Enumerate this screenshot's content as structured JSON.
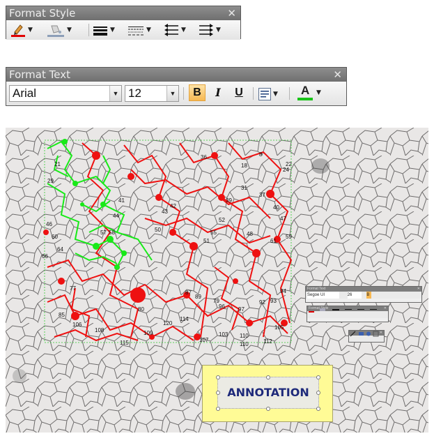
{
  "format_style": {
    "title": "Format Style",
    "close": "✕",
    "buttons": [
      "pen-color",
      "fill-color",
      "line-weight",
      "line-dash",
      "line-start",
      "line-end"
    ]
  },
  "format_text": {
    "title": "Format Text",
    "close": "✕",
    "font": "Arial",
    "size": "12",
    "bold": "B",
    "italic": "I",
    "underline": "U",
    "font_color_label": "A"
  },
  "mini_toolbars": {
    "text_title": "Format Text",
    "text_font": "Segoe UI",
    "text_size": "26",
    "style_title": "Format Style"
  },
  "annotation": {
    "text": "ANNOTATION"
  },
  "grain_labels": [
    {
      "t": "21"
    },
    {
      "t": "29"
    },
    {
      "t": "46"
    },
    {
      "t": "60"
    },
    {
      "t": "64"
    },
    {
      "t": "66"
    },
    {
      "t": "77"
    },
    {
      "t": "85"
    },
    {
      "t": "106"
    },
    {
      "t": "108"
    },
    {
      "t": "115"
    },
    {
      "t": "109"
    },
    {
      "t": "80"
    },
    {
      "t": "57"
    },
    {
      "t": "58"
    },
    {
      "t": "41"
    },
    {
      "t": "44"
    },
    {
      "t": "50"
    },
    {
      "t": "36"
    },
    {
      "t": "39"
    },
    {
      "t": "43"
    },
    {
      "t": "42"
    },
    {
      "t": "52"
    },
    {
      "t": "55"
    },
    {
      "t": "51"
    },
    {
      "t": "48"
    },
    {
      "t": "61"
    },
    {
      "t": "59"
    },
    {
      "t": "47"
    },
    {
      "t": "40"
    },
    {
      "t": "37"
    },
    {
      "t": "31"
    },
    {
      "t": "24"
    },
    {
      "t": "22"
    },
    {
      "t": "8"
    },
    {
      "t": "18"
    },
    {
      "t": "89"
    },
    {
      "t": "87"
    },
    {
      "t": "79"
    },
    {
      "t": "96"
    },
    {
      "t": "94"
    },
    {
      "t": "93"
    },
    {
      "t": "92"
    },
    {
      "t": "97"
    },
    {
      "t": "103"
    },
    {
      "t": "110"
    },
    {
      "t": "112"
    },
    {
      "t": "105"
    },
    {
      "t": "120"
    },
    {
      "t": "114"
    },
    {
      "t": "107"
    },
    {
      "t": "110"
    }
  ]
}
